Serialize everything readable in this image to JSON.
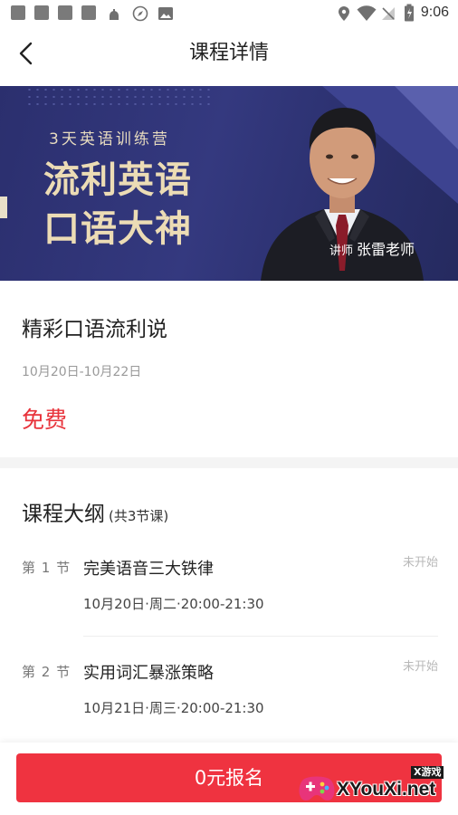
{
  "status_bar": {
    "time": "9:06"
  },
  "header": {
    "title": "课程详情"
  },
  "banner": {
    "subtitle": "3天英语训练营",
    "headline_1": "流利英语",
    "headline_2": "口语大神",
    "teacher_prefix": "讲师",
    "teacher_name": "张雷老师"
  },
  "course": {
    "name": "精彩口语流利说",
    "date_range": "10月20日-10月22日",
    "price": "免费"
  },
  "syllabus": {
    "title": "课程大纲",
    "count": "(共3节课)",
    "lessons": [
      {
        "number": "第 1 节",
        "name": "完美语音三大铁律",
        "time": "10月20日·周二·20:00-21:30",
        "status": "未开始"
      },
      {
        "number": "第 2 节",
        "name": "实用词汇暴涨策略",
        "time": "10月21日·周三·20:00-21:30",
        "status": "未开始"
      }
    ]
  },
  "bottom": {
    "signup_label": "0元报名"
  },
  "watermark": {
    "small": "X游戏",
    "text": "XYouXi.net"
  },
  "colors": {
    "accent": "#ef3340",
    "price": "#e8333b",
    "banner_bg": "#2f3476",
    "banner_text": "#ecdcb5"
  }
}
